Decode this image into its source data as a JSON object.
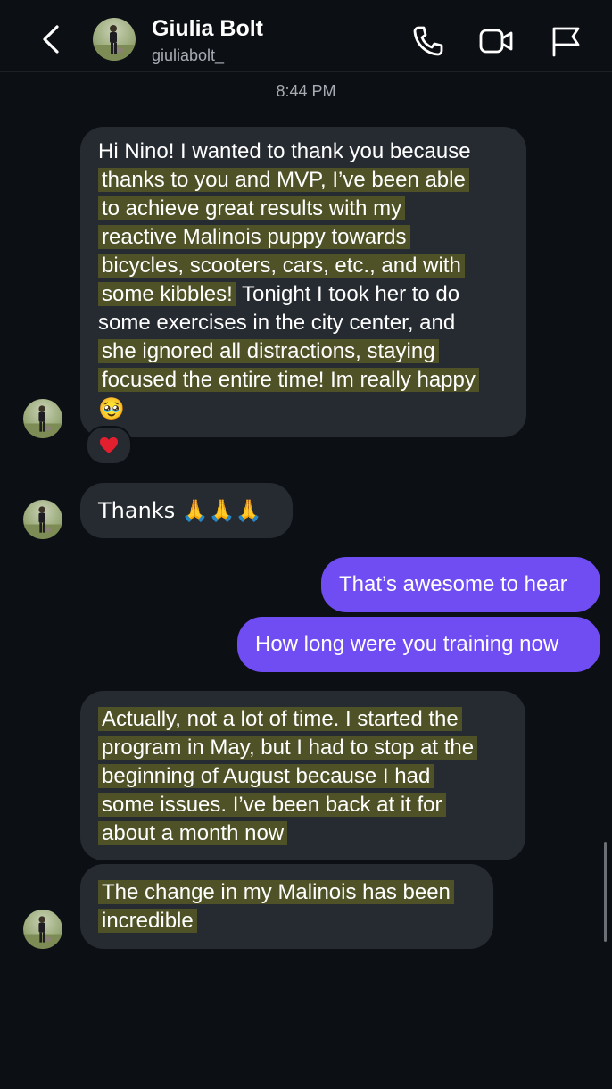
{
  "contact": {
    "name": "Giulia Bolt",
    "handle": "giuliabolt_"
  },
  "icons": {
    "back": "chevron-left-icon",
    "call": "phone-icon",
    "video": "video-camera-icon",
    "report": "flag-icon"
  },
  "timestamp": "8:44 PM",
  "messages": [
    {
      "direction": "incoming",
      "lines": [
        "Hi Nino! I wanted to thank you because",
        "thanks to you and MVP, I’ve been able",
        "to achieve great results with my",
        "reactive Malinois puppy towards",
        "bicycles, scooters, cars, etc., and with",
        "some kibbles!",
        "Tonight I took her to do",
        "some exercises in the city center, and",
        "she ignored all distractions, staying",
        "focused the entire time! Im really happy",
        "🥹"
      ],
      "reaction": "❤️"
    },
    {
      "direction": "incoming",
      "text": "Thanks 🙏🙏🙏"
    },
    {
      "direction": "outgoing",
      "text": "That’s awesome to hear"
    },
    {
      "direction": "outgoing",
      "text": "How long were you training now"
    },
    {
      "direction": "incoming",
      "lines": [
        "Actually, not a lot of time. I started the",
        "program in May, but I had to stop at the",
        "beginning of August because I had",
        "some issues. I’ve been back at it for",
        "about a month now"
      ]
    },
    {
      "direction": "incoming",
      "lines": [
        "The change in my Malinois has been",
        "incredible"
      ]
    }
  ],
  "colors": {
    "background": "#0c0f14",
    "incoming_bubble": "#262a31",
    "outgoing_bubble": "#6f4df2",
    "highlight": "#4f5227"
  }
}
